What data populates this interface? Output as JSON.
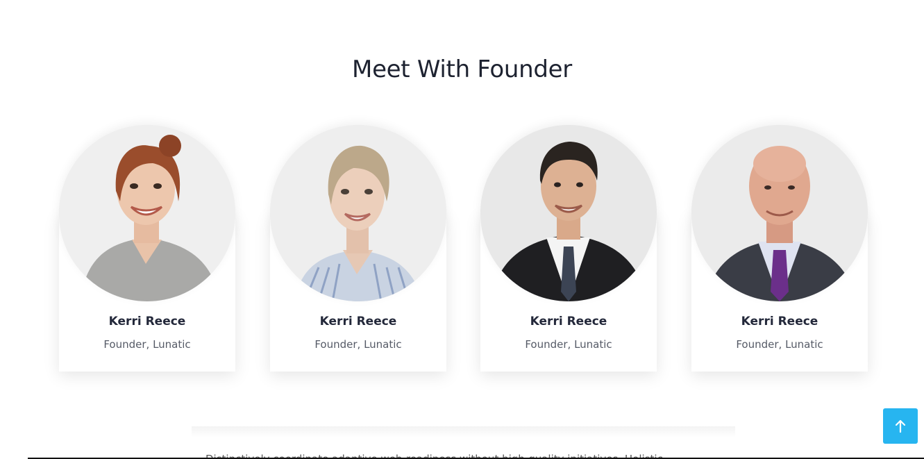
{
  "section": {
    "title": "Meet With Founder"
  },
  "founders": [
    {
      "name": "Kerri Reece",
      "role": "Founder, Lunatic",
      "photo_icon": "woman-smiling-portrait"
    },
    {
      "name": "Kerri Reece",
      "role": "Founder, Lunatic",
      "photo_icon": "woman-blonde-portrait"
    },
    {
      "name": "Kerri Reece",
      "role": "Founder, Lunatic",
      "photo_icon": "man-suit-portrait"
    },
    {
      "name": "Kerri Reece",
      "role": "Founder, Lunatic",
      "photo_icon": "bald-man-suit-portrait"
    }
  ],
  "lower_section": {
    "text": "Distinctively coordinate adaptive web-readiness without high-quality initiatives. Holistic"
  },
  "scroll_to_top": {
    "icon": "arrow-up-icon",
    "color": "#27b5f0"
  }
}
